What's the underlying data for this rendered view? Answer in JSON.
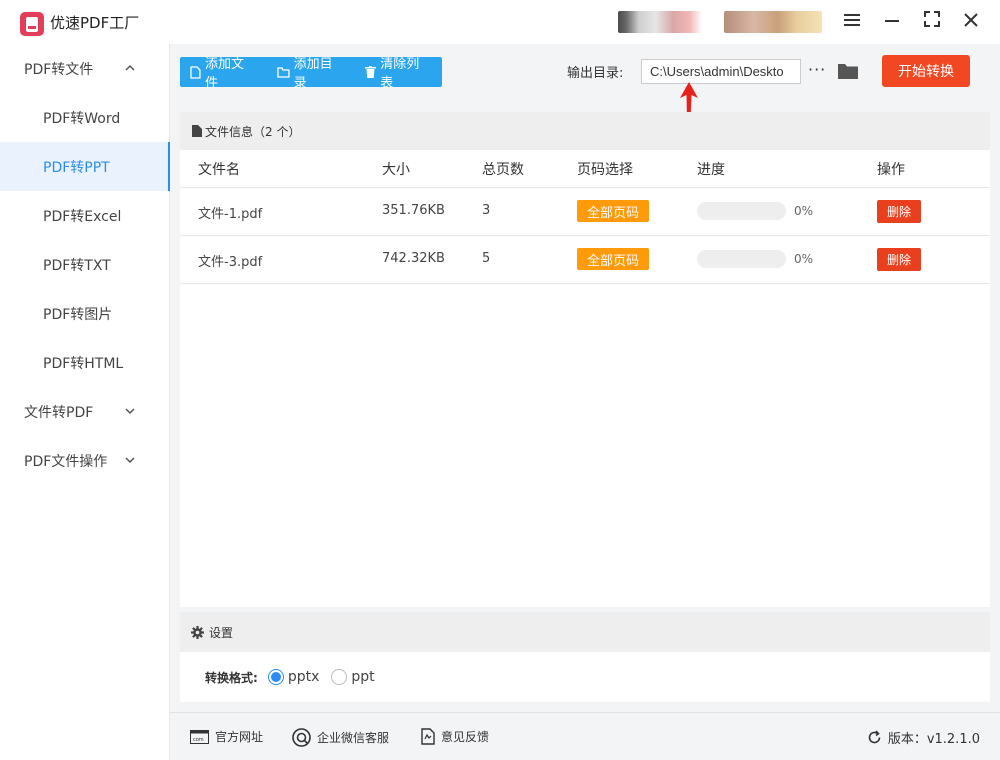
{
  "app": {
    "title": "优速PDF工厂"
  },
  "sidebar": {
    "items": [
      {
        "label": "PDF转文件",
        "group": true,
        "expanded": true
      },
      {
        "label": "PDF转Word"
      },
      {
        "label": "PDF转PPT",
        "active": true
      },
      {
        "label": "PDF转Excel"
      },
      {
        "label": "PDF转TXT"
      },
      {
        "label": "PDF转图片"
      },
      {
        "label": "PDF转HTML"
      },
      {
        "label": "文件转PDF",
        "group": true,
        "expanded": false
      },
      {
        "label": "PDF文件操作",
        "group": true,
        "expanded": false
      }
    ]
  },
  "toolbar": {
    "add_file": "添加文件",
    "add_dir": "添加目录",
    "clear_list": "清除列表",
    "output_label": "输出目录:",
    "output_path": "C:\\Users\\admin\\Deskto",
    "dots": "···",
    "start": "开始转换"
  },
  "file_panel": {
    "title": "文件信息（2 个）",
    "columns": [
      "文件名",
      "大小",
      "总页数",
      "页码选择",
      "进度",
      "操作"
    ],
    "rows": [
      {
        "name": "文件-1.pdf",
        "size": "351.76KB",
        "pages": "3",
        "page_select": "全部页码",
        "progress": 0,
        "progress_text": "0%",
        "action": "删除"
      },
      {
        "name": "文件-3.pdf",
        "size": "742.32KB",
        "pages": "5",
        "page_select": "全部页码",
        "progress": 0,
        "progress_text": "0%",
        "action": "删除"
      }
    ]
  },
  "settings": {
    "title": "设置",
    "format_label": "转换格式:",
    "options": [
      {
        "label": "pptx",
        "selected": true
      },
      {
        "label": "ppt",
        "selected": false
      }
    ]
  },
  "footer": {
    "website": "官方网址",
    "wechat": "企业微信客服",
    "feedback": "意见反馈",
    "version": "版本：v1.2.1.0"
  },
  "colors": {
    "accent": "#2d8cf0",
    "toolbar_blue": "#2ba6ee",
    "start_red": "#f24723",
    "page_orange": "#ff9a0b",
    "delete_red": "#e8401e",
    "arrow_red": "#e8211b"
  }
}
